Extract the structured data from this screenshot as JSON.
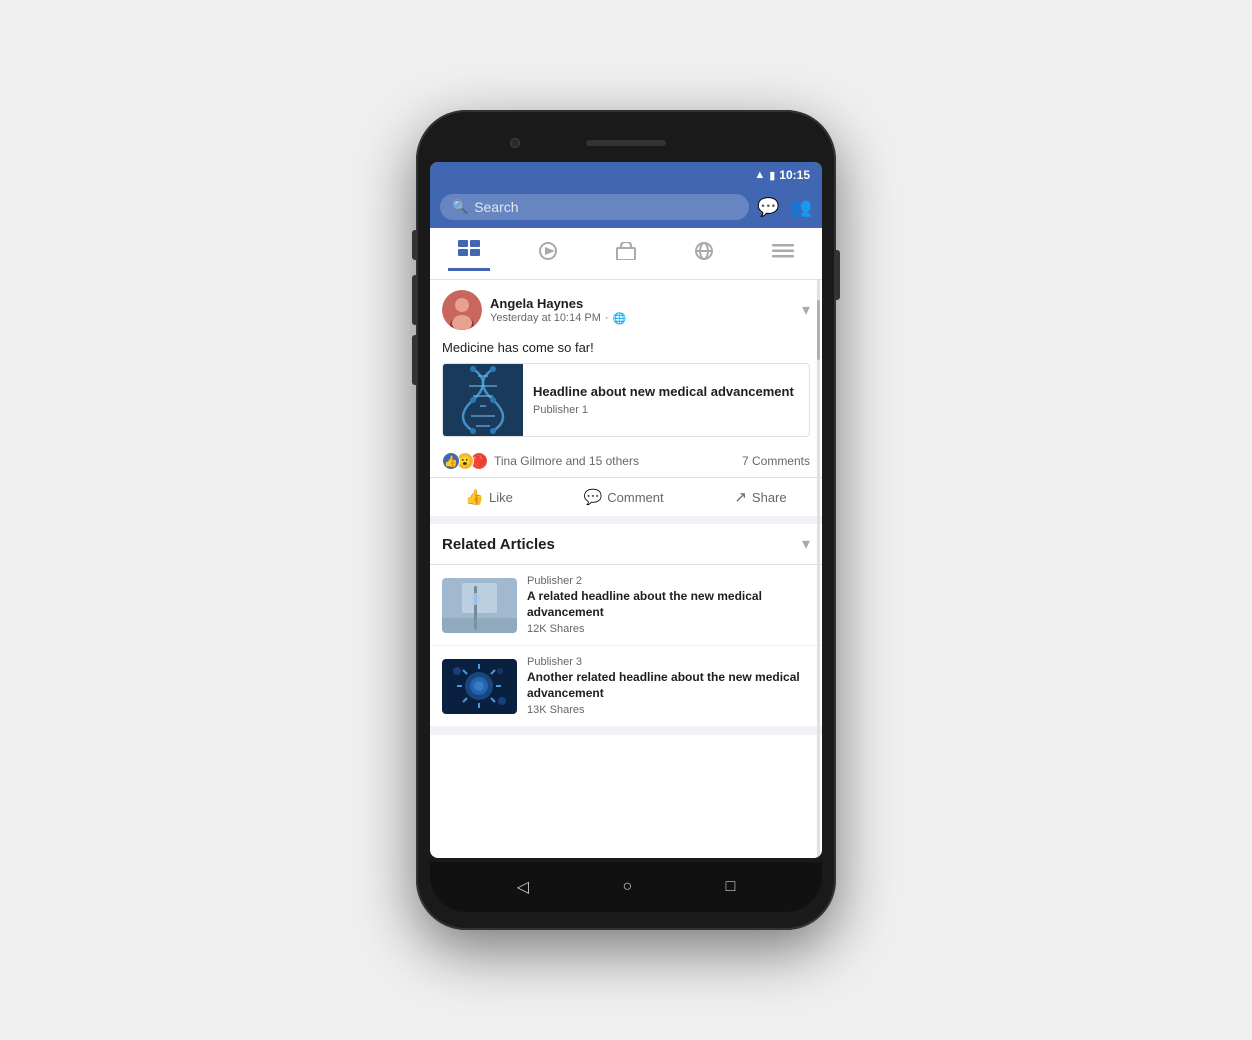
{
  "phone": {
    "time": "10:15",
    "battery_icon": "🔋",
    "wifi_icon": "📶"
  },
  "status_bar": {
    "time": "10:15"
  },
  "search_bar": {
    "placeholder": "Search",
    "messenger_icon": "messenger",
    "people_icon": "people"
  },
  "nav_tabs": [
    {
      "id": "news",
      "label": "News Feed",
      "active": true
    },
    {
      "id": "video",
      "label": "Video"
    },
    {
      "id": "marketplace",
      "label": "Marketplace"
    },
    {
      "id": "globe",
      "label": "Globe"
    },
    {
      "id": "menu",
      "label": "Menu"
    }
  ],
  "post": {
    "author": "Angela Haynes",
    "meta": "Yesterday at 10:14 PM",
    "visibility": "Public",
    "text": "Medicine has come so far!",
    "article": {
      "title": "Headline about new medical advancement",
      "publisher": "Publisher 1"
    },
    "reactions": {
      "likes_label": "Tina Gilmore and 15 others",
      "comments_count": "7 Comments"
    },
    "actions": {
      "like": "Like",
      "comment": "Comment",
      "share": "Share"
    }
  },
  "related_articles": {
    "section_title": "Related Articles",
    "items": [
      {
        "publisher": "Publisher 2",
        "headline": "A related headline about the new medical advancement",
        "shares": "12K Shares"
      },
      {
        "publisher": "Publisher 3",
        "headline": "Another related headline about the new medical advancement",
        "shares": "13K Shares"
      }
    ]
  },
  "bottom_nav": {
    "back": "◁",
    "home": "○",
    "recent": "□"
  }
}
